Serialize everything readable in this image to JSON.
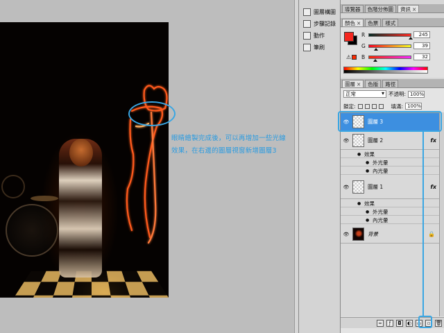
{
  "annotation": {
    "line1": "眼睛繪製完成後，可以再增加一些光線",
    "line2": "效果，在右邊的圖層視窗新增圖層3"
  },
  "dock": {
    "items": [
      {
        "label": "圖層構圖",
        "icon": "layer-comps-icon"
      },
      {
        "label": "步驟記錄",
        "icon": "history-icon"
      },
      {
        "label": "動作",
        "icon": "actions-icon"
      },
      {
        "label": "筆刷",
        "icon": "brushes-icon"
      }
    ]
  },
  "navigator_tabs": [
    "導覽器",
    "色階分佈圖",
    "資訊"
  ],
  "color_tabs": [
    "顏色",
    "色票",
    "樣式"
  ],
  "color": {
    "r_label": "R",
    "g_label": "G",
    "b_label": "B",
    "r": "245",
    "g": "39",
    "b": "32",
    "r_level": 0.96,
    "g_level": 0.15,
    "b_level": 0.13,
    "fg_color": "#f5271f",
    "bg_color": "#000000"
  },
  "layers_tabs": [
    "圖層",
    "色版",
    "路徑"
  ],
  "layers": {
    "blend_mode": "正常",
    "opacity_label": "不透明:",
    "opacity": "100%",
    "lock_label": "鎖定:",
    "fill_label": "填滿:",
    "fill": "100%",
    "rows": [
      {
        "name": "圖層 3",
        "selected": true
      },
      {
        "name": "圖層 2",
        "fx": "fx"
      },
      {
        "name": "圖層 1",
        "fx": "fx"
      },
      {
        "name": "背景"
      }
    ],
    "effects_label": "效果",
    "outer_glow": "外光暈",
    "inner_glow": "內光暈"
  },
  "accent": "#39a6e3"
}
